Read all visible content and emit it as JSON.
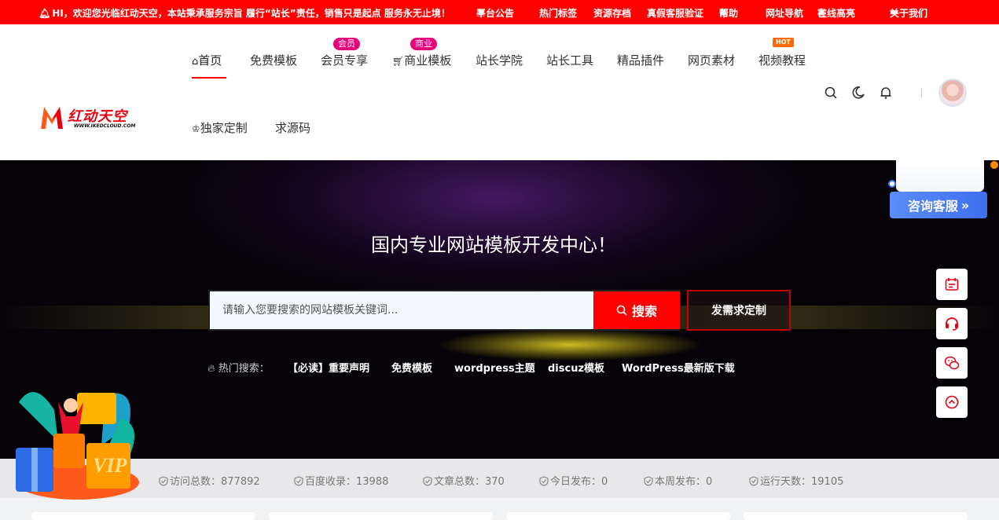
{
  "topbar": {
    "notice": "HI，欢迎您光临红动天空，本站秉承服务宗旨 履行“站长”责任，销售只是起点 服务永无止境！",
    "links": [
      "平台公告",
      "热门标签",
      "资源存档",
      "真假客服验证",
      "帮助",
      "网址导航",
      "在线高亮",
      "关于我们"
    ]
  },
  "logo": {
    "text": "红动天空",
    "url": "WWW.IKEDCLOUD.COM"
  },
  "nav": {
    "items": [
      "首页",
      "免费模板",
      "会员专享",
      "商业模板",
      "站长学院",
      "站长工具",
      "精品插件",
      "网页素材",
      "视频教程",
      "独家定制",
      "求源码"
    ],
    "badges": {
      "vip": "会员",
      "business": "商业",
      "hot": "HOT"
    }
  },
  "hero": {
    "title": "国内专业网站模板开发中心！",
    "search_placeholder": "请输入您要搜索的网站模板关键词...",
    "search_button": "搜索",
    "demand_button": "发需求定制",
    "hot_label": "热门搜索：",
    "hot_keywords": [
      "【必读】重要声明",
      "免费模板",
      "wordpress主题",
      "discuz模板",
      "WordPress最新版下载"
    ]
  },
  "stats": [
    {
      "label": "访问总数：",
      "value": "877892"
    },
    {
      "label": "百度收录：",
      "value": "13988"
    },
    {
      "label": "文章总数：",
      "value": "370"
    },
    {
      "label": "今日发布：",
      "value": "0"
    },
    {
      "label": "本周发布：",
      "value": "0"
    },
    {
      "label": "运行天数：",
      "value": "19105"
    }
  ],
  "floating": {
    "service_button": "咨询客服",
    "vip_text": "VIP"
  },
  "colors": {
    "brand_red": "#ff0000",
    "badge_pink": "#e6007a",
    "hot_orange": "#ff6a00",
    "service_blue": "#4a7df3"
  }
}
